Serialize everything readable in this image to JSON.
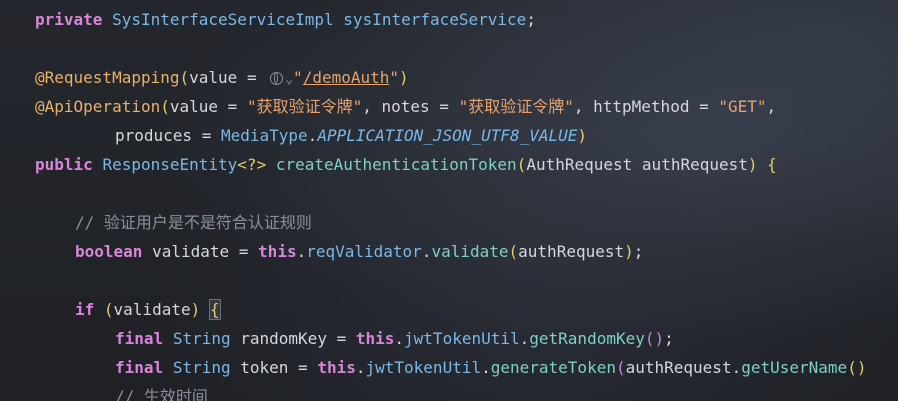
{
  "code": {
    "line1": {
      "kw": "private",
      "type": "SysInterfaceServiceImpl",
      "field": "sysInterfaceService",
      "end": ";"
    },
    "line3": {
      "ann": "@RequestMapping",
      "open": "(",
      "attr": "value",
      "eq": " = ",
      "globe_icon": "globe-icon",
      "chevron": "⌄",
      "q1": "\"",
      "url": "/demoAuth",
      "q2": "\"",
      "close": ")"
    },
    "line4": {
      "ann": "@ApiOperation",
      "open": "(",
      "attr1": "value",
      "eq": " = ",
      "str1": "\"获取验证令牌\"",
      "comma1": ", ",
      "attr2": "notes",
      "str2": "\"获取验证令牌\"",
      "comma2": ", ",
      "attr3": "httpMethod",
      "str3": "\"GET\"",
      "comma3": ","
    },
    "line5": {
      "attr": "produces",
      "eq": " = ",
      "type": "MediaType",
      "dot": ".",
      "constant": "APPLICATION_JSON_UTF8_VALUE",
      "close": ")"
    },
    "line6": {
      "kw": "public",
      "type": "ResponseEntity",
      "generic": "<?>",
      "method": "createAuthenticationToken",
      "open": "(",
      "ptype": "AuthRequest",
      "pname": "authRequest",
      "close": ")",
      "brace": "{"
    },
    "line8": {
      "comment": "// 验证用户是不是符合认证规则"
    },
    "line9": {
      "kw": "boolean",
      "var": "validate",
      "eq": " = ",
      "this": "this",
      "dot1": ".",
      "field": "reqValidator",
      "dot2": ".",
      "method": "validate",
      "open": "(",
      "arg": "authRequest",
      "close": ")",
      "end": ";"
    },
    "line11": {
      "kw": "if",
      "open": "(",
      "var": "validate",
      "close": ")",
      "brace": "{"
    },
    "line12": {
      "kw": "final",
      "type": "String",
      "var": "randomKey",
      "eq": " = ",
      "this": "this",
      "dot1": ".",
      "field": "jwtTokenUtil",
      "dot2": ".",
      "method": "getRandomKey",
      "parens": "()",
      "end": ";"
    },
    "line13": {
      "kw": "final",
      "type": "String",
      "var": "token",
      "eq": " = ",
      "this": "this",
      "dot1": ".",
      "field": "jwtTokenUtil",
      "dot2": ".",
      "method": "generateToken",
      "open": "(",
      "arg": "authRequest",
      "dot3": ".",
      "method2": "getUserName",
      "parens": "()"
    },
    "line14": {
      "comment": "// 生效时间"
    }
  },
  "colors": {
    "keyword": "#d985d9",
    "type": "#7ab8e8",
    "annotation": "#e8b06a",
    "string": "#e8a36d",
    "method": "#7fd0c3",
    "comment": "#8a8f99",
    "background": "#1f2126"
  }
}
